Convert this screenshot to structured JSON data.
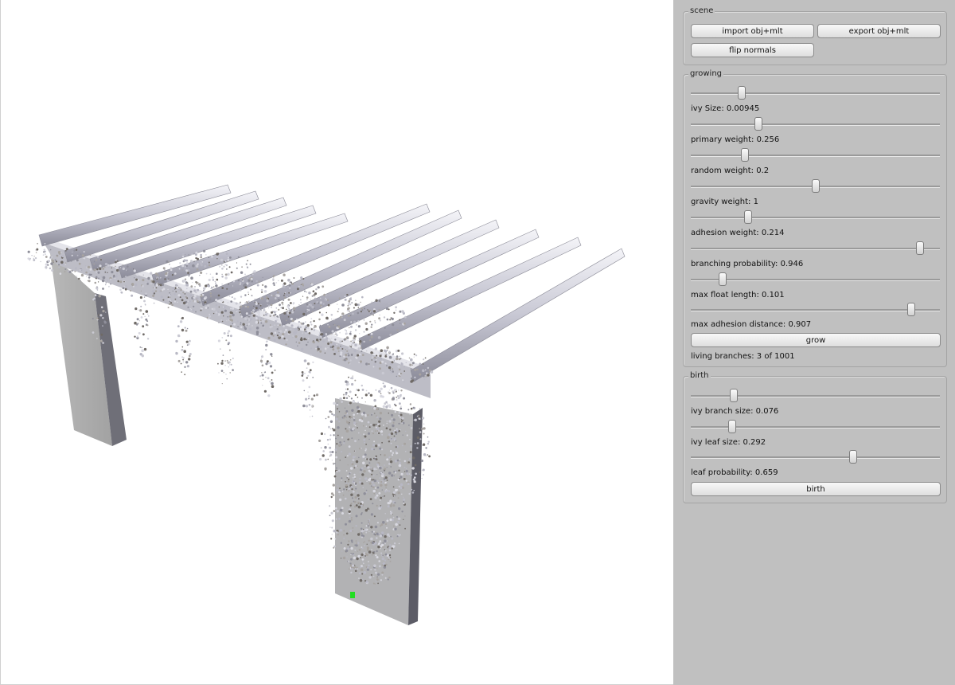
{
  "scene": {
    "title": "scene",
    "import_label": "import obj+mlt",
    "export_label": "export obj+mlt",
    "flip_label": "flip normals"
  },
  "growing": {
    "title": "growing",
    "sliders": [
      {
        "label": "ivy Size: 0.00945",
        "fraction": 0.195
      },
      {
        "label": "primary weight: 0.256",
        "fraction": 0.263
      },
      {
        "label": "random weight: 0.2",
        "fraction": 0.209
      },
      {
        "label": "gravity weight: 1",
        "fraction": 0.503
      },
      {
        "label": "adhesion weight: 0.214",
        "fraction": 0.222
      },
      {
        "label": "branching probability: 0.946",
        "fraction": 0.935
      },
      {
        "label": "max float length: 0.101",
        "fraction": 0.114
      },
      {
        "label": "max adhesion distance: 0.907",
        "fraction": 0.898
      }
    ],
    "grow_label": "grow",
    "status": "living branches: 3 of 1001"
  },
  "birth": {
    "title": "birth",
    "sliders": [
      {
        "label": "ivy branch size: 0.076",
        "fraction": 0.161
      },
      {
        "label": "ivy leaf size: 0.292",
        "fraction": 0.155
      },
      {
        "label": "leaf probability: 0.659",
        "fraction": 0.656
      }
    ],
    "birth_label": "birth"
  },
  "colors": {
    "panel": "#c0c0c0",
    "viewport": "#ffffff",
    "marker": "#22dd22"
  }
}
